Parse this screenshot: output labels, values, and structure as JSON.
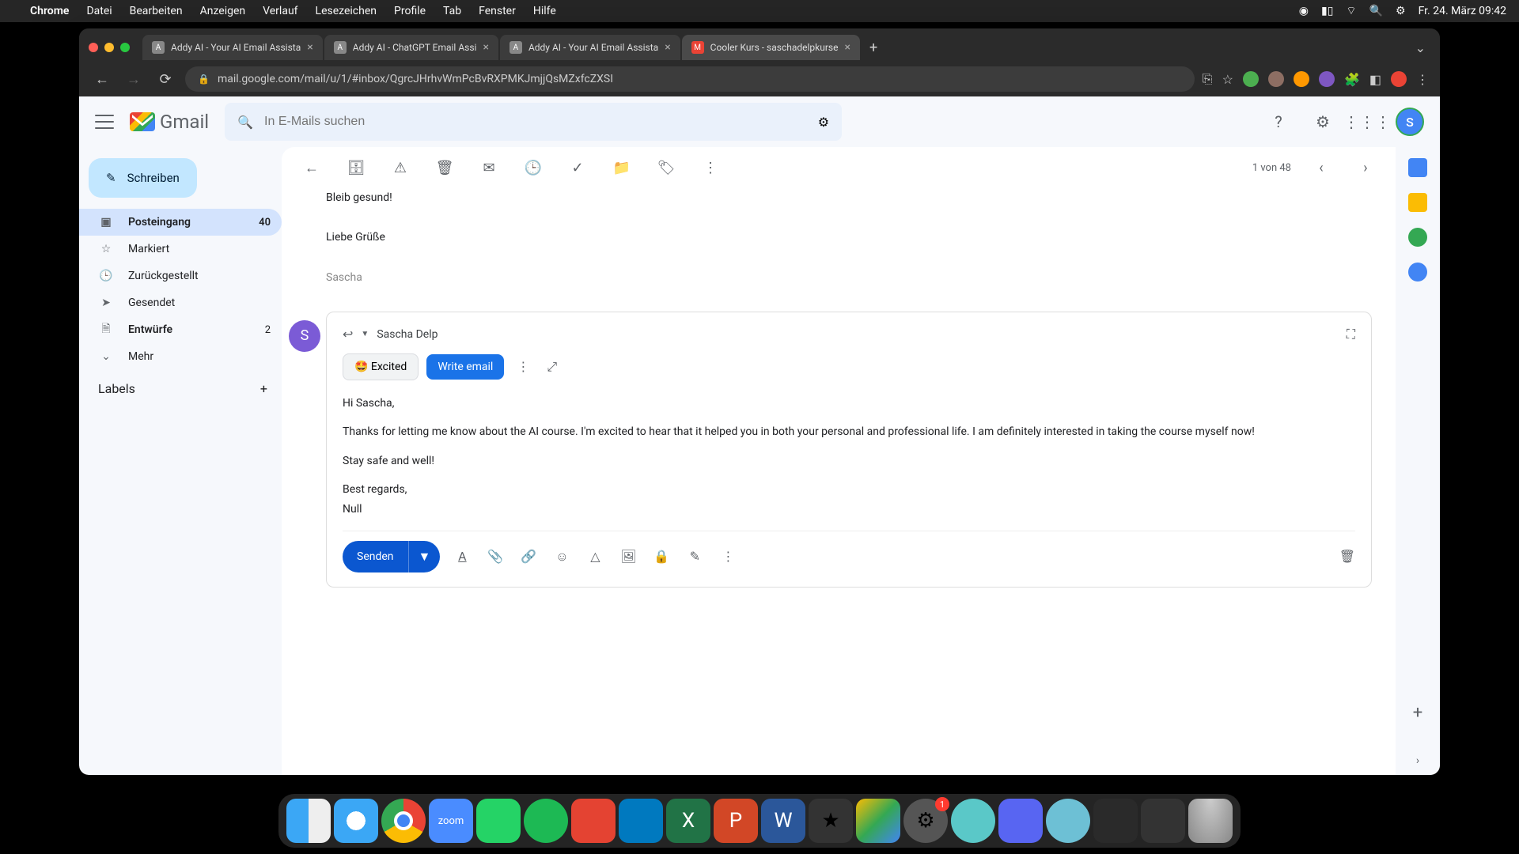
{
  "menubar": {
    "app": "Chrome",
    "items": [
      "Datei",
      "Bearbeiten",
      "Anzeigen",
      "Verlauf",
      "Lesezeichen",
      "Profile",
      "Tab",
      "Fenster",
      "Hilfe"
    ],
    "clock": "Fr. 24. März  09:42"
  },
  "tabs": [
    {
      "title": "Addy AI - Your AI Email Assista"
    },
    {
      "title": "Addy AI - ChatGPT Email Assi"
    },
    {
      "title": "Addy AI - Your AI Email Assista"
    },
    {
      "title": "Cooler Kurs - saschadelpkurse",
      "active": true
    }
  ],
  "url": "mail.google.com/mail/u/1/#inbox/QgrcJHrhvWmPcBvRXPMKJmjjQsMZxfcZXSI",
  "gmail": {
    "logo": "Gmail",
    "search_placeholder": "In E-Mails suchen",
    "compose": "Schreiben",
    "nav": [
      {
        "label": "Posteingang",
        "count": "40",
        "active": true
      },
      {
        "label": "Markiert"
      },
      {
        "label": "Zurückgestellt"
      },
      {
        "label": "Gesendet"
      },
      {
        "label": "Entwürfe",
        "count": "2"
      },
      {
        "label": "Mehr"
      }
    ],
    "labels_header": "Labels",
    "page_info": "1 von 48",
    "avatar_letter": "S"
  },
  "prev_message": {
    "line1": "Bleib gesund!",
    "line2": "Liebe Grüße",
    "sig": "Sascha"
  },
  "reply": {
    "to_name": "Sascha Delp",
    "avatar_letter": "S",
    "chip_excited": "🤩 Excited",
    "chip_write": "Write email",
    "body": {
      "greeting": "Hi Sascha,",
      "p1": "Thanks for letting me know about the AI course. I'm excited to hear that it helped you in both your personal and professional life. I am definitely interested in taking the course myself now!",
      "p2": "Stay safe and well!",
      "closing": "Best regards,",
      "sig": "Null"
    },
    "send": "Senden"
  }
}
